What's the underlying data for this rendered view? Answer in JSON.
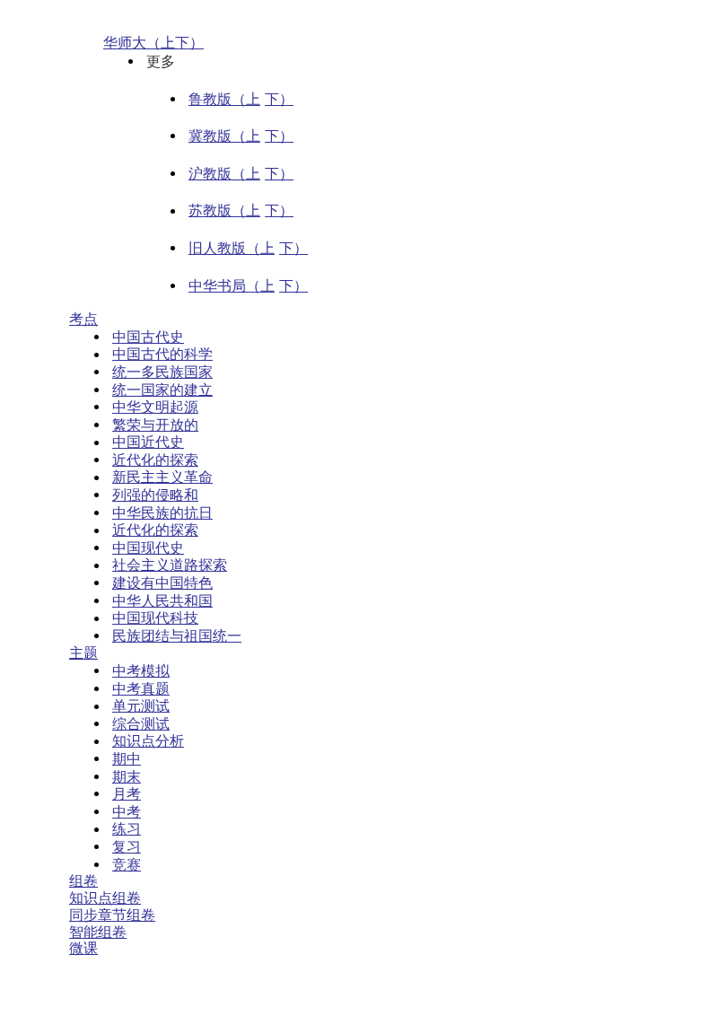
{
  "editions": {
    "current": {
      "links": [
        "华师大（上",
        "下）"
      ]
    },
    "more": {
      "label": "更多",
      "items": [
        {
          "links": [
            "鲁教版（上",
            "下）"
          ]
        },
        {
          "links": [
            "冀教版（上",
            "下）"
          ]
        },
        {
          "links": [
            "沪教版（上",
            "下）"
          ]
        },
        {
          "links": [
            "苏教版（上",
            "下）"
          ]
        },
        {
          "links": [
            "旧人教版（上",
            "下）"
          ]
        },
        {
          "links": [
            "中华书局（上",
            "下）"
          ]
        }
      ]
    }
  },
  "sections": [
    {
      "title": "考点",
      "items": [
        "中国古代史",
        "中国古代的科学",
        "统一多民族国家",
        "统一国家的建立",
        "中华文明起源",
        "繁荣与开放的",
        "中国近代史",
        "近代化的探索",
        "新民主主义革命",
        "列强的侵略和",
        "中华民族的抗日",
        "近代化的探索",
        "中国现代史",
        "社会主义道路探索",
        "建设有中国特色",
        "中华人民共和国",
        "中国现代科技",
        "民族团结与祖国统一"
      ]
    },
    {
      "title": "主题",
      "items": [
        "中考模拟",
        "中考真题",
        "单元测试",
        "综合测试",
        "知识点分析",
        "期中",
        "期末",
        "月考",
        "中考",
        "练习",
        "复习",
        "竞赛"
      ]
    }
  ],
  "links": [
    "组卷",
    "知识点组卷",
    "同步章节组卷",
    "智能组卷",
    "微课"
  ]
}
